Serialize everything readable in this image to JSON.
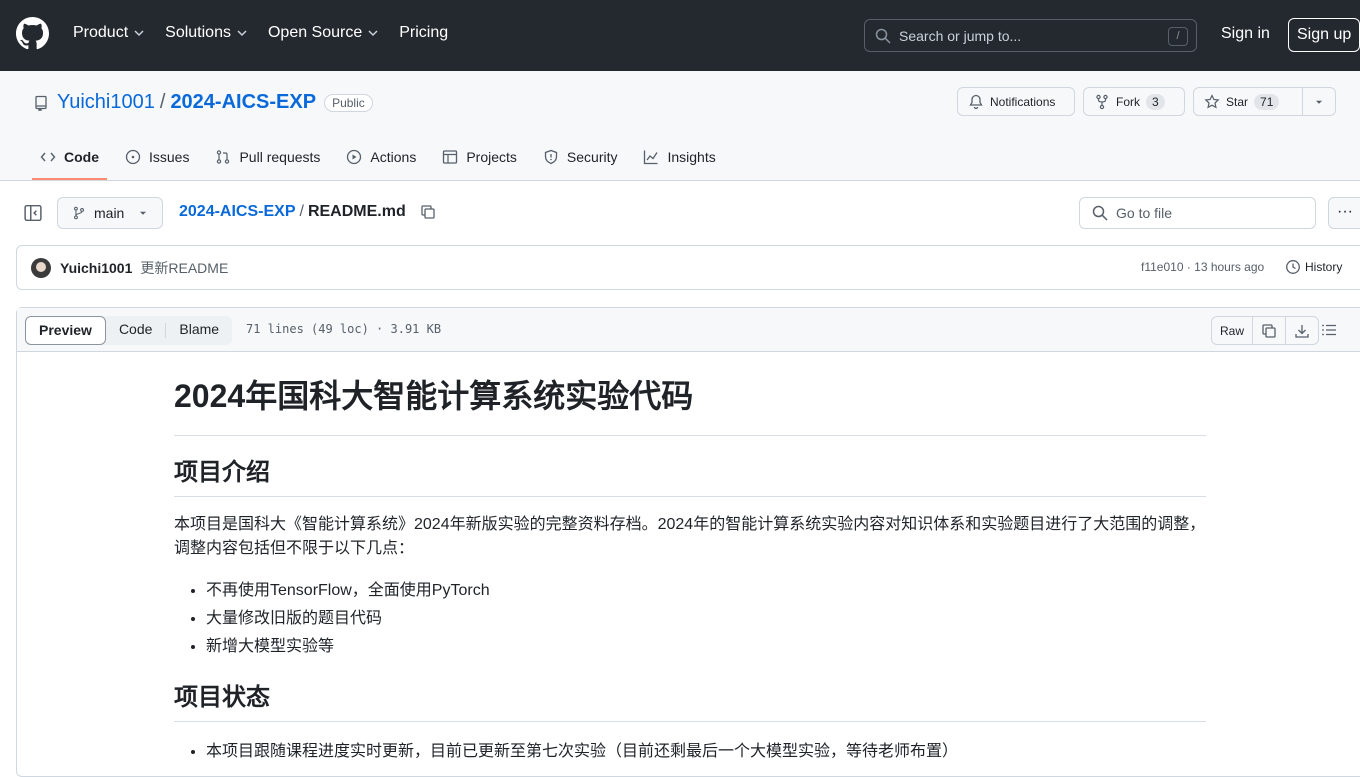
{
  "nav": {
    "items": [
      {
        "label": "Product",
        "has_menu": true
      },
      {
        "label": "Solutions",
        "has_menu": true
      },
      {
        "label": "Open Source",
        "has_menu": true
      },
      {
        "label": "Pricing",
        "has_menu": false
      }
    ],
    "search_placeholder": "Search or jump to...",
    "search_shortcut": "/",
    "sign_in": "Sign in",
    "sign_up": "Sign up"
  },
  "repo": {
    "owner": "Yuichi1001",
    "separator": "/",
    "name": "2024-AICS-EXP",
    "visibility": "Public",
    "notifications_label": "Notifications",
    "fork_label": "Fork",
    "fork_count": "3",
    "star_label": "Star",
    "star_count": "71"
  },
  "tabs": [
    {
      "label": "Code",
      "icon": "code-icon",
      "active": true
    },
    {
      "label": "Issues",
      "icon": "issue-icon"
    },
    {
      "label": "Pull requests",
      "icon": "pull-request-icon"
    },
    {
      "label": "Actions",
      "icon": "play-icon"
    },
    {
      "label": "Projects",
      "icon": "table-icon"
    },
    {
      "label": "Security",
      "icon": "shield-icon"
    },
    {
      "label": "Insights",
      "icon": "graph-icon"
    }
  ],
  "file": {
    "branch": "main",
    "path_repo": "2024-AICS-EXP",
    "path_sep": "/",
    "path_file": "README.md",
    "goto_placeholder": "Go to file",
    "more": "···"
  },
  "commit": {
    "author": "Yuichi1001",
    "message": "更新README",
    "meta": "f11e010 · 13 hours ago",
    "history": "History"
  },
  "viewer": {
    "modes": [
      "Preview",
      "Code",
      "Blame"
    ],
    "active_mode": "Preview",
    "meta": "71 lines (49 loc) · 3.91 KB",
    "raw": "Raw"
  },
  "readme": {
    "title": "2024年国科大智能计算系统实验代码",
    "section1": "项目介绍",
    "intro": "本项目是国科大《智能计算系统》2024年新版实验的完整资料存档。2024年的智能计算系统实验内容对知识体系和实验题目进行了大范围的调整，调整内容包括但不限于以下几点：",
    "bullets": [
      "不再使用TensorFlow，全面使用PyTorch",
      "大量修改旧版的题目代码",
      "新增大模型实验等"
    ],
    "section2": "项目状态",
    "status": "本项目跟随课程进度实时更新，目前已更新至第七次实验（目前还剩最后一个大模型实验，等待老师布置）"
  }
}
